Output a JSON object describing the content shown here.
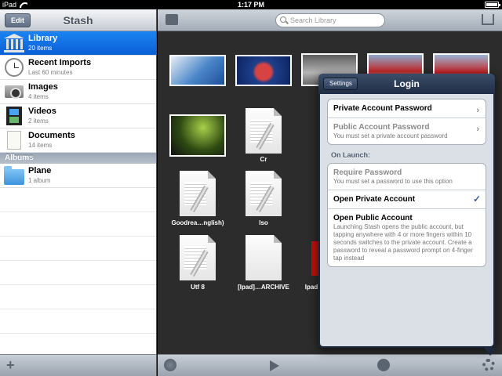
{
  "status": {
    "device": "iPad",
    "time": "1:17 PM"
  },
  "sidebar": {
    "title": "Stash",
    "edit_label": "Edit",
    "items": [
      {
        "name": "Library",
        "sub": "20 items",
        "icon": "library-icon"
      },
      {
        "name": "Recent Imports",
        "sub": "Last 60 minutes",
        "icon": "clock-icon"
      },
      {
        "name": "Images",
        "sub": "4 items",
        "icon": "camera-icon"
      },
      {
        "name": "Videos",
        "sub": "2 items",
        "icon": "film-icon"
      },
      {
        "name": "Documents",
        "sub": "14 items",
        "icon": "document-icon"
      }
    ],
    "albums_header": "Albums",
    "albums": [
      {
        "name": "Plane",
        "sub": "1 album",
        "icon": "folder-icon"
      }
    ],
    "add_label": "+"
  },
  "main": {
    "search_placeholder": "Search Library",
    "docs": [
      "Cr",
      "Goodrea…nglish)",
      "Iso",
      "Utf 8",
      "[Ipad]…ARCHIVE",
      "Ipad"
    ]
  },
  "popover": {
    "back_label": "Settings",
    "title": "Login",
    "private_pw": "Private Account Password",
    "public_pw": "Public Account Password",
    "public_pw_sub": "You must set a private account password",
    "on_launch_header": "On Launch:",
    "require_pw": "Require Password",
    "require_pw_sub": "You must set a password to use this option",
    "open_private": "Open Private Account",
    "open_public": "Open Public Account",
    "open_public_sub": "Launching Stash opens the public account, but tapping anywhere with 4 or more fingers within 10 seconds switches to the private account. Create a password to reveal a password prompt on 4-finger tap instead"
  },
  "colors": {
    "selection": "#0b5fd6",
    "popover_frame": "#1d2a3d",
    "grid_bg": "#2c2c2c"
  }
}
